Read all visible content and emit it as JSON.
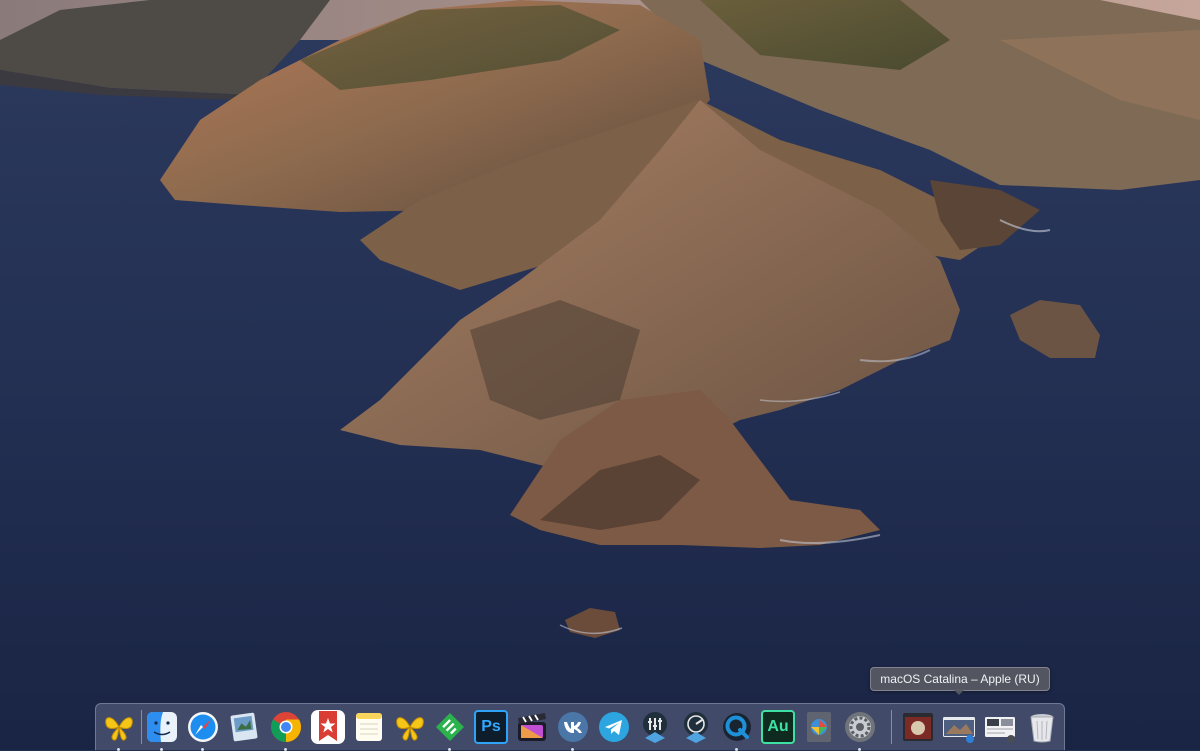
{
  "desktop": {
    "wallpaper": "macOS Catalina island wallpaper"
  },
  "tooltip": {
    "text": "macOS Catalina – Apple (RU)"
  },
  "dock": {
    "items": [
      {
        "name": "Butterfly",
        "icon": "butterfly-icon",
        "color": "#f5c518"
      },
      {
        "name": "Finder",
        "icon": "finder-icon",
        "color": "#2e8ef0"
      },
      {
        "name": "Safari",
        "icon": "safari-icon",
        "color": "#1d8df0"
      },
      {
        "name": "Preview",
        "icon": "preview-icon",
        "color": "#6d9cc9"
      },
      {
        "name": "Google Chrome",
        "icon": "chrome-icon",
        "color": "#4285f4"
      },
      {
        "name": "Wunderlist",
        "icon": "star-list-icon",
        "color": "#d93d34"
      },
      {
        "name": "Notes",
        "icon": "notes-icon",
        "color": "#f9d55c"
      },
      {
        "name": "Butterfly",
        "icon": "butterfly-icon",
        "color": "#f5c518"
      },
      {
        "name": "Feedly",
        "icon": "feedly-icon",
        "color": "#2bb24c"
      },
      {
        "name": "Photoshop",
        "icon": "photoshop-icon",
        "label": "Ps",
        "color": "#31a8ff"
      },
      {
        "name": "Final Cut Pro",
        "icon": "clapper-icon",
        "color": "#c04fd4"
      },
      {
        "name": "VK",
        "icon": "vk-icon",
        "color": "#4a76a8"
      },
      {
        "name": "Telegram",
        "icon": "telegram-icon",
        "color": "#2ca5e0"
      },
      {
        "name": "Logic Pro",
        "icon": "logic-icon",
        "color": "#1f2f3c"
      },
      {
        "name": "Logic Remote",
        "icon": "logic-remote-icon",
        "color": "#1f2f3c"
      },
      {
        "name": "QuickTime Player",
        "icon": "quicktime-icon",
        "color": "#1e90d8"
      },
      {
        "name": "Audition",
        "icon": "audition-icon",
        "label": "Au",
        "color": "#3fe0a3"
      },
      {
        "name": "Pixelmator",
        "icon": "pixelmator-icon",
        "color": "#6a6f7a"
      },
      {
        "name": "System Preferences",
        "icon": "gear-icon",
        "color": "#8a8d93"
      },
      {
        "name": "Minimized window",
        "icon": "window-thumbnail-icon",
        "color": "#b0473b"
      },
      {
        "name": "macOS Catalina – Apple (RU)",
        "icon": "catalina-thumbnail-icon",
        "color": "#5a6a8a"
      },
      {
        "name": "Downloads",
        "icon": "folder-stack-icon",
        "color": "#e8e8ea"
      },
      {
        "name": "Trash",
        "icon": "trash-icon",
        "color": "#dcdde2"
      }
    ]
  }
}
